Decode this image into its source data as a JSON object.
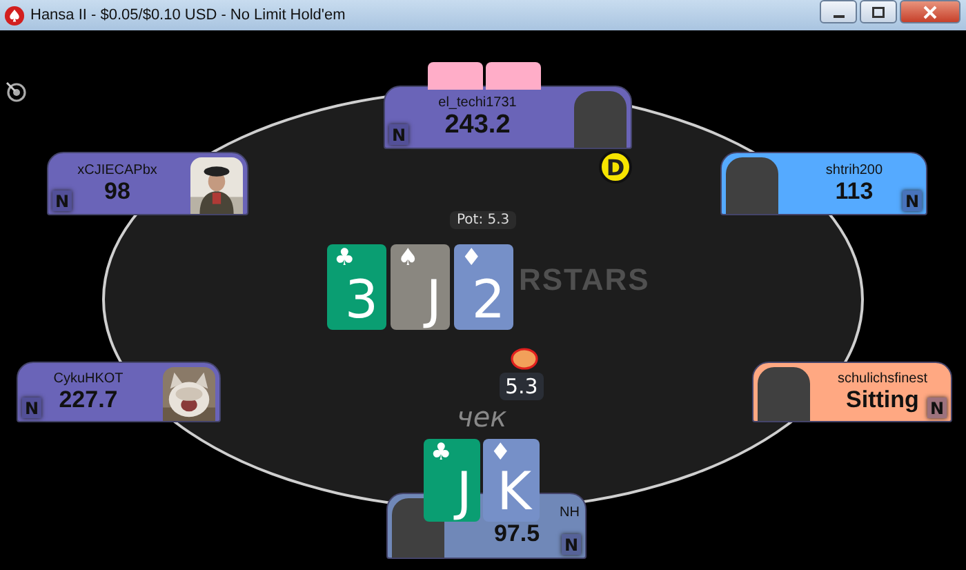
{
  "window": {
    "title": "Hansa II - $0.05/$0.10 USD - No Limit Hold'em"
  },
  "table": {
    "logo": "RSTARS",
    "pot": "Pot: 5.3",
    "dealer_button": "D",
    "bet": "5.3",
    "action": "чек",
    "board": [
      {
        "rank": "3",
        "suit": "♣",
        "color": "#0a9e72"
      },
      {
        "rank": "J",
        "suit": "♠",
        "color": "#8a8780"
      },
      {
        "rank": "2",
        "suit": "♦",
        "color": "#7690c8"
      }
    ]
  },
  "seats": [
    {
      "name": "el_techi1731",
      "stack": "243.2",
      "color": "#6a64b8",
      "avatar": {
        "kind": "blank"
      },
      "note": "N",
      "hole_cards": [
        {
          "kind": "back"
        },
        {
          "kind": "back"
        }
      ]
    },
    {
      "name": "xCJIECAPbx",
      "stack": "98",
      "color": "#6a64b8",
      "note": "N"
    },
    {
      "name": "shtrih200",
      "stack": "113",
      "color": "#55aaff",
      "avatar": {
        "kind": "blank"
      },
      "note": "N"
    },
    {
      "name": "CykuHKOT",
      "stack": "227.7",
      "color": "#6a64b8",
      "note": "N"
    },
    {
      "name": "schulichsfinest",
      "stack": "Sitting",
      "color": "#ffa882",
      "avatar": {
        "kind": "blank"
      },
      "note": "N"
    },
    {
      "name": "NH",
      "stack": "97.5",
      "color": "#7088b8",
      "avatar": {
        "kind": "blank"
      },
      "note": "N",
      "hole_cards": [
        {
          "kind": "face",
          "rank": "J",
          "suit": "♣",
          "color": "#0a9e72"
        },
        {
          "kind": "face",
          "rank": "K",
          "suit": "♦",
          "color": "#7690c8"
        }
      ]
    }
  ]
}
